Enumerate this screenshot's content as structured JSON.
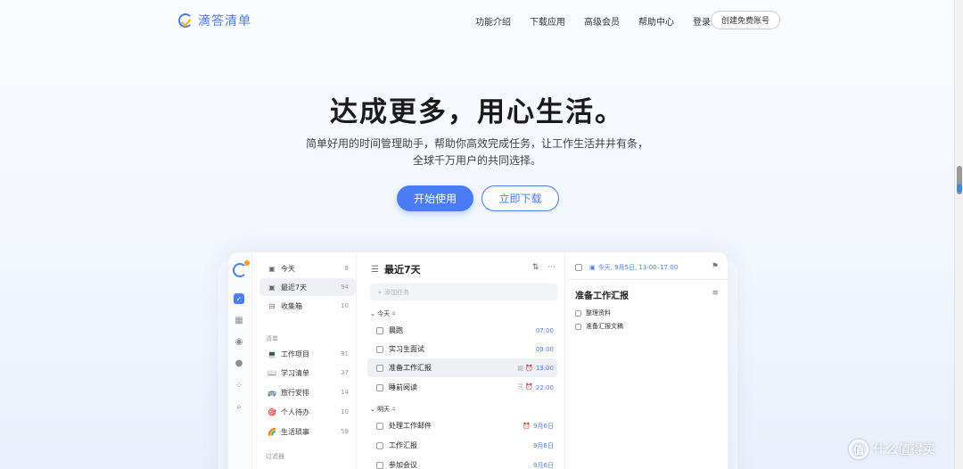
{
  "header": {
    "logo_text": "滴答清单",
    "nav": [
      "功能介绍",
      "下载应用",
      "高级会员",
      "帮助中心",
      "登录"
    ],
    "signup_label": "创建免费账号"
  },
  "hero": {
    "title": "达成更多，用心生活。",
    "subtitle_line1": "简单好用的时间管理助手，帮助你高效完成任务，让工作生活井井有条，",
    "subtitle_line2": "全球千万用户的共同选择。",
    "start_label": "开始使用",
    "download_label": "立即下载"
  },
  "app": {
    "sidebar": {
      "smart": [
        {
          "icon": "calendar-today-icon",
          "label": "今天",
          "count": "8"
        },
        {
          "icon": "calendar-week-icon",
          "label": "最近7天",
          "count": "94"
        },
        {
          "icon": "inbox-icon",
          "label": "收集箱",
          "count": "10"
        }
      ],
      "lists_heading": "清单",
      "lists": [
        {
          "emoji": "💻",
          "label": "工作项目",
          "count": "91"
        },
        {
          "emoji": "📖",
          "label": "学习清单",
          "count": "37"
        },
        {
          "emoji": "🚌",
          "label": "旅行安排",
          "count": "14"
        },
        {
          "emoji": "🎯",
          "label": "个人待办",
          "count": "10"
        },
        {
          "emoji": "🌈",
          "label": "生活琐事",
          "count": "59"
        }
      ],
      "filters_heading": "过滤器"
    },
    "list": {
      "title": "最近7天",
      "add_placeholder": "+ 添加任务",
      "today_heading": "今天",
      "today_count": "4",
      "today_tasks": [
        {
          "title": "晨跑",
          "time": "07:00",
          "icons": ""
        },
        {
          "title": "实习生面试",
          "time": "09:00",
          "icons": ""
        },
        {
          "title": "准备工作汇报",
          "time": "13:00",
          "icons": "▤ ⏰"
        },
        {
          "title": "睡前阅读",
          "time": "22:00",
          "icons": "⎘ ⏰"
        }
      ],
      "tomorrow_heading": "明天",
      "tomorrow_count": "4",
      "tomorrow_tasks": [
        {
          "title": "处理工作邮件",
          "time": "9月6日",
          "icons": "⏰"
        },
        {
          "title": "工作汇报",
          "time": "9月6日",
          "icons": ""
        },
        {
          "title": "参加会议",
          "time": "9月6日",
          "icons": ""
        }
      ]
    },
    "detail": {
      "date": "今天, 9月5日, 13:00–17:00",
      "title": "准备工作汇报",
      "items": [
        "整理资料",
        "准备汇报文稿"
      ]
    }
  },
  "watermark": {
    "text": "什么值得买",
    "logo_char": "值"
  },
  "colors": {
    "accent": "#4a7cf5",
    "orange": "#ffb020"
  }
}
